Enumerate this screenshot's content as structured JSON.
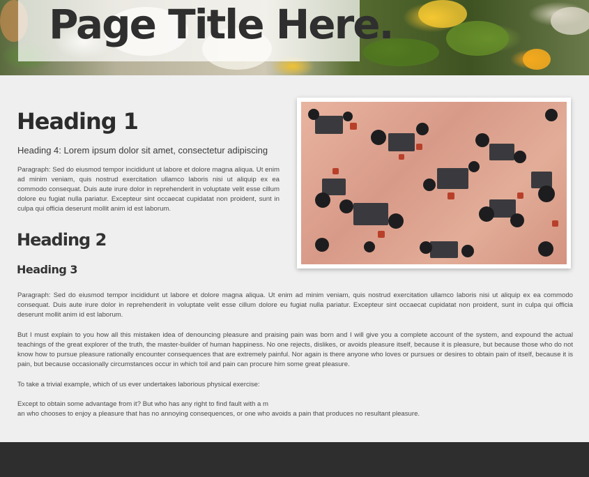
{
  "hero": {
    "title": "Page Title Here."
  },
  "content": {
    "heading1": "Heading 1",
    "heading4": "Heading 4: Lorem ipsum dolor sit amet, consectetur adipiscing",
    "paragraph1": "Paragraph: Sed do eiusmod tempor incididunt ut labore et dolore magna aliqua. Ut enim ad minim veniam, quis nostrud exercitation ullamco laboris nisi ut aliquip ex ea commodo consequat. Duis aute irure dolor in reprehenderit in voluptate velit esse cillum dolore eu fugiat nulla pariatur. Excepteur sint occaecat cupidatat non proident, sunt in culpa qui officia deserunt mollit anim id est laborum.",
    "heading2": "Heading 2",
    "heading3": "Heading 3",
    "paragraph2": "Paragraph: Sed do eiusmod tempor incididunt ut labore et dolore magna aliqua. Ut enim ad minim veniam, quis nostrud exercitation ullamco laboris nisi ut aliquip ex ea commodo consequat. Duis aute irure dolor in reprehenderit in voluptate velit esse cillum dolore eu fugiat nulla pariatur. Excepteur sint occaecat cupidatat non proident, sunt in culpa qui officia deserunt mollit anim id est laborum.",
    "paragraph3": "But I must explain to you how all this mistaken idea of denouncing pleasure and praising pain was born and I will give you a complete account of the system, and expound the actual teachings of the great explorer of the truth, the master-builder of human happiness. No one rejects, dislikes, or avoids pleasure itself, because it is pleasure, but because those who do not know how to pursue pleasure rationally encounter consequences that are extremely painful. Nor again is there anyone who loves or pursues or desires to obtain pain of itself, because it is pain, but because occasionally circumstances occur in which toil and pain can procure him some great pleasure.",
    "paragraph4": "To take a trivial example, which of us ever undertakes laborious physical exercise:",
    "paragraph5_line1": "Except to obtain some advantage from it? But who has any right to find fault with a m",
    "paragraph5_line2": "an who chooses to enjoy a pleasure that has no annoying consequences, or one who avoids a pain that produces no resultant pleasure."
  }
}
